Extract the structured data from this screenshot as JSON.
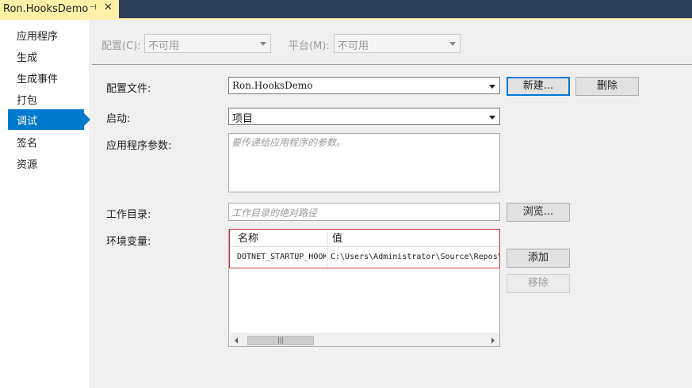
{
  "tab": {
    "title": "Ron.HooksDemo",
    "pin_glyph": "⊣",
    "close_glyph": "✕"
  },
  "nav": {
    "items": [
      {
        "label": "应用程序"
      },
      {
        "label": "生成"
      },
      {
        "label": "生成事件"
      },
      {
        "label": "打包"
      },
      {
        "label": "调试",
        "selected": true
      },
      {
        "label": "签名"
      },
      {
        "label": "资源"
      }
    ]
  },
  "config_bar": {
    "config_label": "配置(C):",
    "config_value": "不可用",
    "platform_label": "平台(M):",
    "platform_value": "不可用"
  },
  "form": {
    "profile_label": "配置文件:",
    "profile_value": "Ron.HooksDemo",
    "new_button": "新建...",
    "delete_button": "删除",
    "launch_label": "启动:",
    "launch_value": "项目",
    "args_label": "应用程序参数:",
    "args_placeholder": "要传递给应用程序的参数。",
    "workdir_label": "工作目录:",
    "workdir_placeholder": "工作目录的绝对路径",
    "browse_button": "浏览...",
    "env_label": "环境变量:",
    "add_button": "添加",
    "remove_button": "移除"
  },
  "env_grid": {
    "col_name": "名称",
    "col_value": "值",
    "rows": [
      {
        "name": "DOTNET_STARTUP_HOOKS",
        "value": "C:\\Users\\Administrator\\Source\\Repos\\Ron"
      }
    ],
    "scroll_thumb": "|||"
  },
  "colors": {
    "accent": "#007acc",
    "tab_active": "#fff2a8",
    "title_bar": "#2d3e5a",
    "highlight_border": "#c8303b"
  }
}
